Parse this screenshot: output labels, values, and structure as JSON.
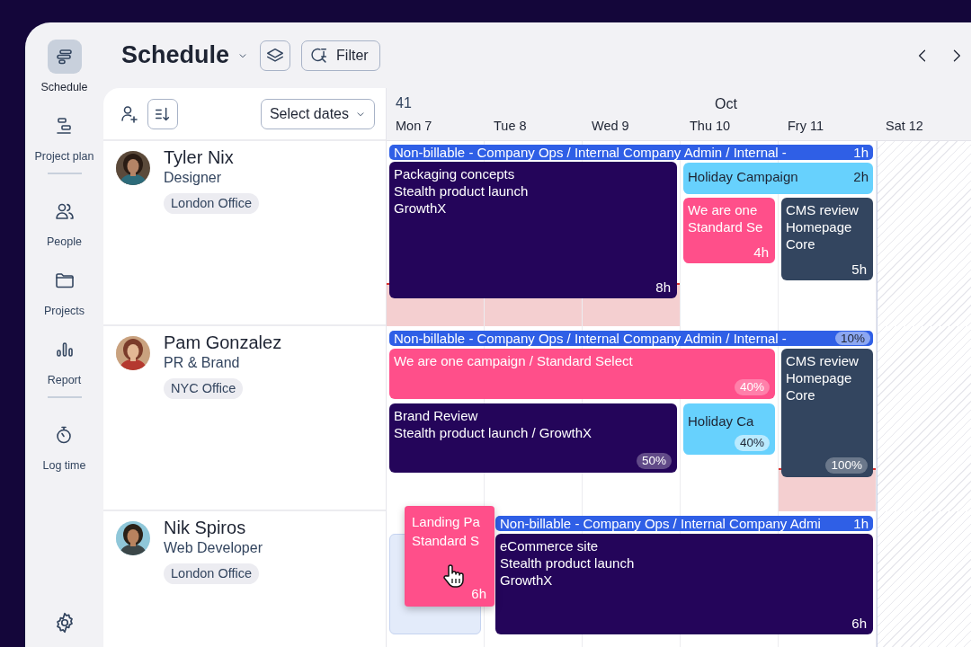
{
  "sidebar": {
    "groups": [
      [
        {
          "label": "Schedule",
          "selected": true
        },
        {
          "label": "Project plan",
          "selected": false
        }
      ],
      [
        {
          "label": "People",
          "selected": false
        },
        {
          "label": "Projects",
          "selected": false
        },
        {
          "label": "Report",
          "selected": false
        }
      ],
      [
        {
          "label": "Log time",
          "selected": false
        }
      ]
    ]
  },
  "header": {
    "title": "Schedule",
    "filter_label": "Filter"
  },
  "people_toolbar": {
    "date_picker": "Select dates"
  },
  "calendar": {
    "week": "41",
    "month": "Oct",
    "days": [
      {
        "label": "Mon 7",
        "weekend": false
      },
      {
        "label": "Tue 8",
        "weekend": false
      },
      {
        "label": "Wed 9",
        "weekend": false
      },
      {
        "label": "Thu 10",
        "weekend": false
      },
      {
        "label": "Fry 11",
        "weekend": false
      },
      {
        "label": "Sat 12",
        "weekend": true
      }
    ]
  },
  "people": [
    {
      "name": "Tyler Nix",
      "role": "Designer",
      "office": "London Office",
      "kind": "hours",
      "days": [
        {
          "overbooked": true
        },
        {
          "overbooked": true
        },
        {
          "overbooked": true
        },
        {
          "overbooked": false
        },
        {
          "overbooked": false
        }
      ],
      "events": [
        {
          "kind": "bar",
          "lines": [
            "Non-billable - Company Ops / Internal Company Admin / Internal -"
          ],
          "amount": "1h",
          "color": "#2f5fe6"
        },
        {
          "kind": "block",
          "lines": [
            "Packaging concepts",
            "Stealth product launch",
            "GrowthX"
          ],
          "amount": "8h",
          "color": "#24055a"
        },
        {
          "kind": "block",
          "lines": [
            "Holiday Campaign"
          ],
          "amount": "2h",
          "color": "#67d1fd"
        },
        {
          "kind": "block",
          "lines": [
            "We are one",
            "Standard Se"
          ],
          "amount": "4h",
          "color": "#ff4f8a"
        },
        {
          "kind": "block",
          "lines": [
            "CMS review",
            "Homepage",
            "Core"
          ],
          "amount": "5h",
          "color": "#33455f"
        }
      ]
    },
    {
      "name": "Pam Gonzalez",
      "role": "PR & Brand",
      "office": "NYC Office",
      "kind": "percent",
      "days": [
        {
          "overbooked": false
        },
        {
          "overbooked": false
        },
        {
          "overbooked": false
        },
        {
          "overbooked": false
        },
        {
          "overbooked": true
        }
      ],
      "events": [
        {
          "kind": "bar",
          "lines": [
            "Non-billable - Company Ops / Internal Company Admin / Internal -"
          ],
          "amount": "10%",
          "color": "#2f5fe6"
        },
        {
          "kind": "block",
          "lines": [
            "We are one campaign / Standard Select"
          ],
          "amount": "40%",
          "color": "#ff4f8a"
        },
        {
          "kind": "block",
          "lines": [
            "Brand Review",
            "Stealth product launch / GrowthX"
          ],
          "amount": "50%",
          "color": "#24055a"
        },
        {
          "kind": "block",
          "lines": [
            "Holiday Ca"
          ],
          "amount": "40%",
          "color": "#67d1fd"
        },
        {
          "kind": "block",
          "lines": [
            "CMS review",
            "Homepage",
            "Core"
          ],
          "amount": "100%",
          "color": "#33455f"
        }
      ]
    },
    {
      "name": "Nik Spiros",
      "role": "Web Developer",
      "office": "London Office",
      "kind": "hours",
      "events": [
        {
          "kind": "placeholder"
        },
        {
          "kind": "bar",
          "lines": [
            "Non-billable - Company Ops / Internal Company Admi"
          ],
          "amount": "1h",
          "color": "#2f5fe6"
        },
        {
          "kind": "block",
          "lines": [
            "eCommerce site",
            "Stealth product launch",
            "GrowthX"
          ],
          "amount": "6h",
          "color": "#24055a"
        }
      ],
      "dragged": {
        "lines": [
          "Landing Pa",
          "Standard S"
        ],
        "amount": "6h",
        "color": "#ff4f8a"
      }
    }
  ]
}
